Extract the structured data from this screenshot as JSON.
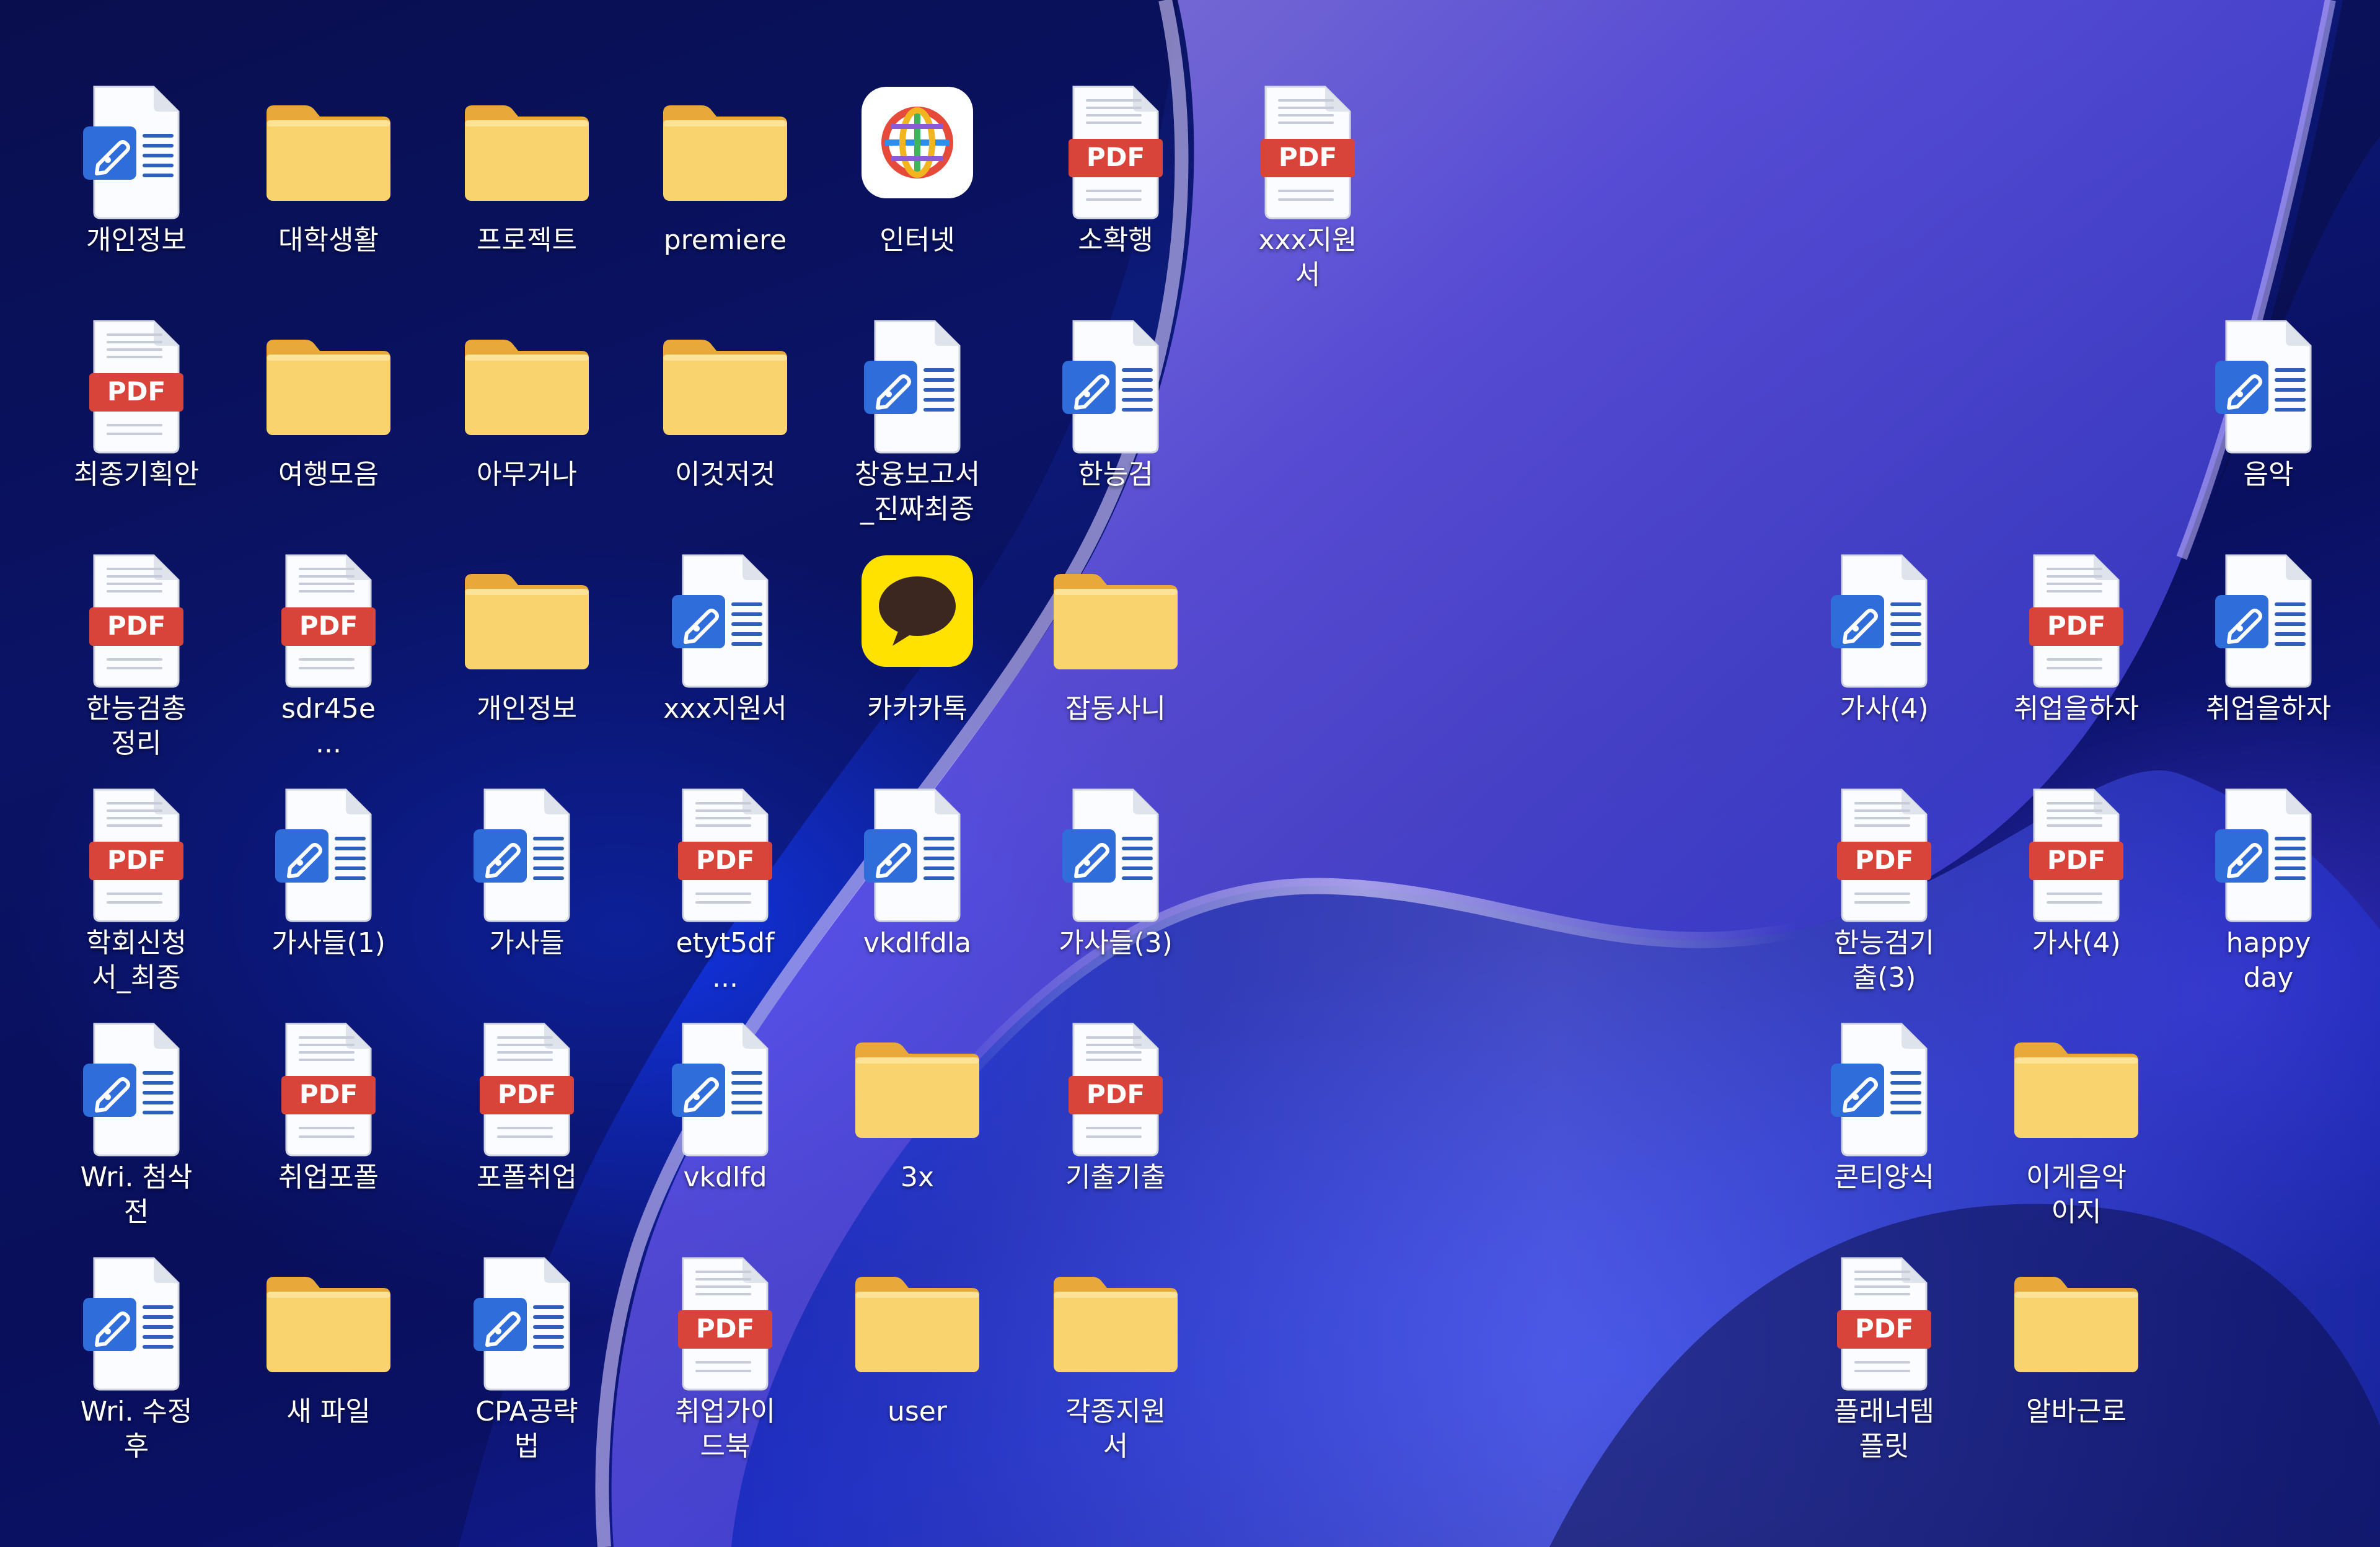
{
  "desktop": {
    "items": [
      {
        "label": "개인정보",
        "type": "doc"
      },
      {
        "label": "대학생활",
        "type": "folder"
      },
      {
        "label": "프로젝트",
        "type": "folder"
      },
      {
        "label": "premiere",
        "type": "folder"
      },
      {
        "label": "인터넷",
        "type": "browser"
      },
      {
        "label": "소확행",
        "type": "pdf"
      },
      {
        "label": "xxx지원\n서",
        "type": "pdf"
      },
      {
        "label": "최종기획안",
        "type": "pdf"
      },
      {
        "label": "여행모음",
        "type": "folder"
      },
      {
        "label": "아무거나",
        "type": "folder"
      },
      {
        "label": "이것저것",
        "type": "folder"
      },
      {
        "label": "창융보고서\n_진짜최종",
        "type": "doc"
      },
      {
        "label": "한능검",
        "type": "doc"
      },
      {
        "label": "음악",
        "type": "doc"
      },
      {
        "label": "한능검총\n정리",
        "type": "pdf"
      },
      {
        "label": "sdr45e\n...",
        "type": "pdf"
      },
      {
        "label": "개인정보",
        "type": "folder"
      },
      {
        "label": "xxx지원서",
        "type": "doc"
      },
      {
        "label": "카카카톡",
        "type": "chat"
      },
      {
        "label": "잡동사니",
        "type": "folder"
      },
      {
        "label": "가사(4)",
        "type": "doc"
      },
      {
        "label": "취업을하자",
        "type": "pdf"
      },
      {
        "label": "취업을하자",
        "type": "doc"
      },
      {
        "label": "학회신청\n서_최종",
        "type": "pdf"
      },
      {
        "label": "가사들(1)",
        "type": "doc"
      },
      {
        "label": "가사들",
        "type": "doc"
      },
      {
        "label": "etyt5df\n...",
        "type": "pdf"
      },
      {
        "label": "vkdlfdla",
        "type": "doc"
      },
      {
        "label": "가사들(3)",
        "type": "doc"
      },
      {
        "label": "한능검기\n출(3)",
        "type": "pdf"
      },
      {
        "label": "가사(4)",
        "type": "pdf"
      },
      {
        "label": "happy\nday",
        "type": "doc"
      },
      {
        "label": "Wri. 첨삭\n전",
        "type": "doc"
      },
      {
        "label": "취업포폴",
        "type": "pdf"
      },
      {
        "label": "포폴취업",
        "type": "pdf"
      },
      {
        "label": "vkdlfd",
        "type": "doc"
      },
      {
        "label": "3x",
        "type": "folder"
      },
      {
        "label": "기출기출",
        "type": "pdf"
      },
      {
        "label": "콘티양식",
        "type": "doc"
      },
      {
        "label": "이게음악\n이지",
        "type": "folder"
      },
      {
        "label": "Wri. 수정\n후",
        "type": "doc"
      },
      {
        "label": "새 파일",
        "type": "folder"
      },
      {
        "label": "CPA공략\n법",
        "type": "doc"
      },
      {
        "label": "취업가이\n드북",
        "type": "pdf"
      },
      {
        "label": "user",
        "type": "folder"
      },
      {
        "label": "각종지원\n서",
        "type": "folder"
      },
      {
        "label": "플래너템\n플릿",
        "type": "pdf"
      },
      {
        "label": "알바근로",
        "type": "folder"
      }
    ],
    "pdf_badge_text": "PDF",
    "colors": {
      "folder": "#f9d36d",
      "folder_tab": "#e9a93a",
      "pdf_red": "#d9443a",
      "doc_blue": "#2f6ddb",
      "kakao_yellow": "#ffe200"
    }
  }
}
